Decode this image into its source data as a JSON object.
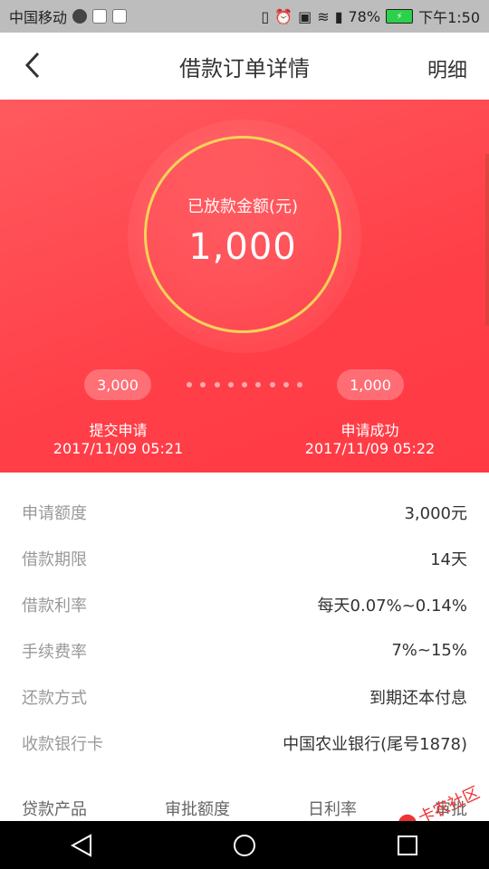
{
  "status_bar": {
    "carrier": "中国移动",
    "battery_percent": "78%",
    "time": "下午1:50"
  },
  "header": {
    "title": "借款订单详情",
    "detail_link": "明细"
  },
  "hero": {
    "amount_label": "已放款金额(元)",
    "amount_value": "1,000",
    "left_pill": "3,000",
    "right_pill": "1,000",
    "left_step_title": "提交申请",
    "left_step_time": "2017/11/09 05:21",
    "right_step_title": "申请成功",
    "right_step_time": "2017/11/09 05:22"
  },
  "info_rows": [
    {
      "label": "申请额度",
      "value": "3,000元"
    },
    {
      "label": "借款期限",
      "value": "14天"
    },
    {
      "label": "借款利率",
      "value": "每天0.07%~0.14%"
    },
    {
      "label": "手续费率",
      "value": "7%~15%"
    },
    {
      "label": "还款方式",
      "value": "到期还本付息"
    },
    {
      "label": "收款银行卡",
      "value": "中国农业银行(尾号1878)"
    }
  ],
  "table_headers": [
    "贷款产品",
    "审批额度",
    "日利率",
    "审批"
  ],
  "watermark": {
    "text": "卡农社区"
  },
  "colors": {
    "accent_red": "#ff4a51",
    "ring_gold": "#f3d35a"
  },
  "icons": {
    "back": "chevron-left-icon",
    "nav_back": "triangle-back-icon",
    "nav_home": "circle-home-icon",
    "nav_recent": "square-recent-icon"
  }
}
